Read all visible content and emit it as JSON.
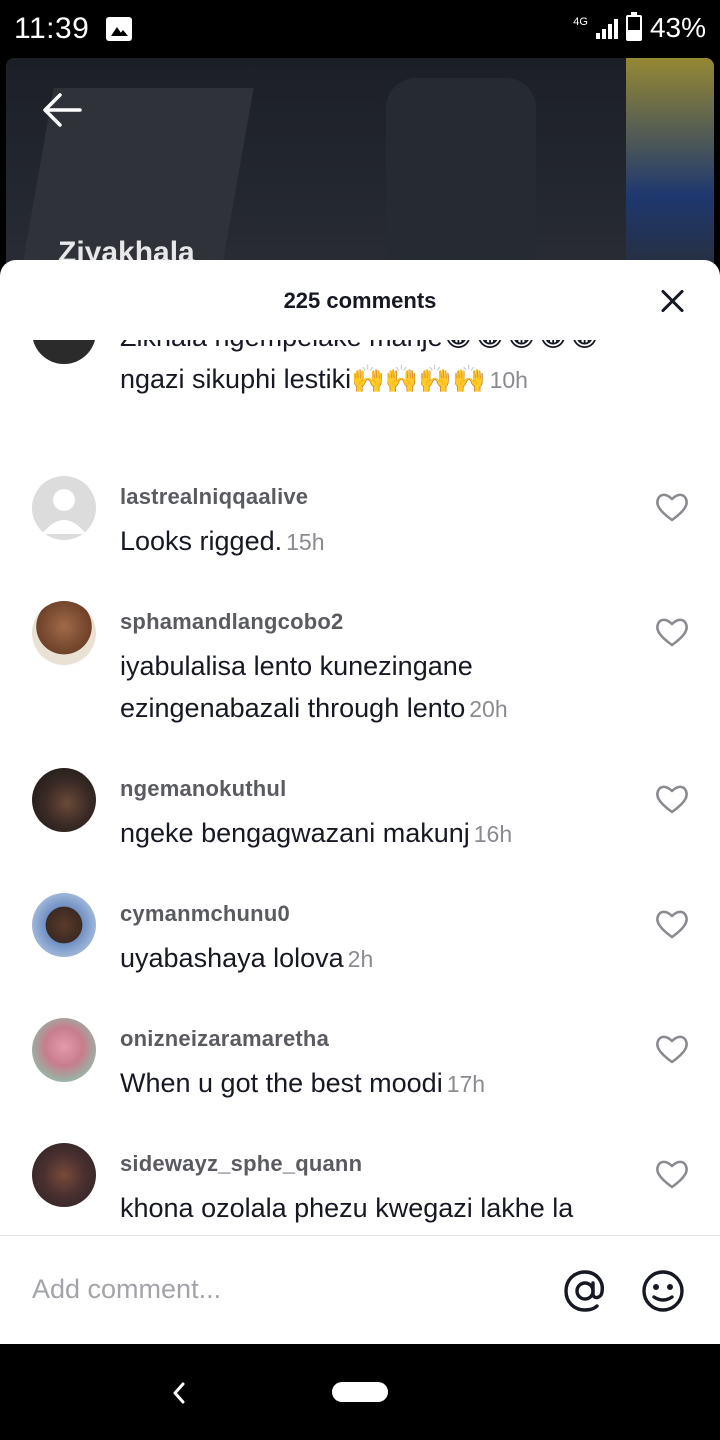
{
  "status_bar": {
    "time": "11:39",
    "network": "4G",
    "battery_percent": "43%",
    "battery_level": 0.43,
    "image_notification_icon": "image-icon"
  },
  "video": {
    "title": "Ziyakhala"
  },
  "sheet": {
    "title": "225 comments",
    "close_icon": "close-icon"
  },
  "comments": [
    {
      "username": "",
      "text": "Zikhala ngempelake manje😂😂😂😂😂ngazi sikuphi lestiki🙌🙌🙌🙌",
      "time": "10h",
      "avatar_color": "#2b2b2b",
      "action_icon": "chevron-down-icon"
    },
    {
      "username": "lastrealniqqaalive",
      "text": "Looks rigged.",
      "time": "15h",
      "avatar_color": "#dcdcdc",
      "action_icon": "heart-icon"
    },
    {
      "username": "sphamandlangcobo2",
      "text": "iyabulalisa lento kunezingane ezingenabazali through lento",
      "time": "20h",
      "avatar_color": "#8c5a3c",
      "action_icon": "heart-icon"
    },
    {
      "username": "ngemanokuthul",
      "text": "ngeke bengagwazani makunj",
      "time": "16h",
      "avatar_color": "#3a2a24",
      "action_icon": "heart-icon"
    },
    {
      "username": "cymanmchunu0",
      "text": "uyabashaya lolova",
      "time": "2h",
      "avatar_color": "#5f7fb0",
      "action_icon": "heart-icon"
    },
    {
      "username": "onizneizaramaretha",
      "text": "When u got the best moodi",
      "time": "17h",
      "avatar_color": "#c77d8c",
      "action_icon": "heart-icon"
    },
    {
      "username": "sidewayz_sphe_quann",
      "text": "khona ozolala phezu kwegazi lakhe la",
      "time": "",
      "avatar_color": "#4a3030",
      "action_icon": "heart-icon"
    }
  ],
  "input": {
    "placeholder": "Add comment...",
    "mention_icon": "at-icon",
    "emoji_icon": "emoji-icon"
  },
  "nav": {
    "back_icon": "nav-back-icon",
    "home_icon": "home-pill-icon"
  }
}
